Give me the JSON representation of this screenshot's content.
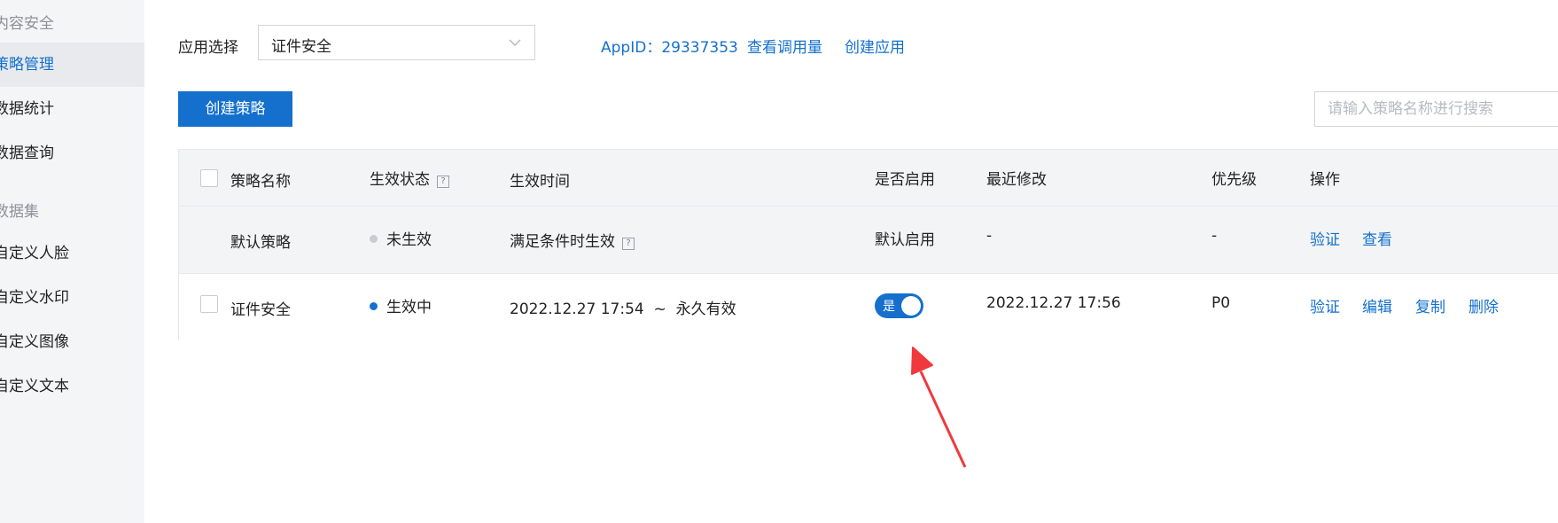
{
  "sidebar": {
    "group1": "内容安全",
    "items1": [
      {
        "label": "策略管理",
        "active": true
      },
      {
        "label": "数据统计",
        "active": false
      },
      {
        "label": "数据查询",
        "active": false
      }
    ],
    "group2": "数据集",
    "items2": [
      {
        "label": "自定义人脸"
      },
      {
        "label": "自定义水印"
      },
      {
        "label": "自定义图像"
      },
      {
        "label": "自定义文本"
      }
    ]
  },
  "toolbar": {
    "app_select_label": "应用选择",
    "app_select_value": "证件安全",
    "appid_label": "AppID：",
    "appid_value": "29337353",
    "view_usage": "查看调用量",
    "create_app": "创建应用",
    "create_strategy": "创建策略",
    "search_placeholder": "请输入策略名称进行搜索"
  },
  "table": {
    "headers": [
      "策略名称",
      "生效状态",
      "生效时间",
      "是否启用",
      "最近修改",
      "优先级",
      "操作"
    ],
    "rows": [
      {
        "name": "默认策略",
        "status": "未生效",
        "status_color": "#c9cbcf",
        "time": "满足条件时生效",
        "enabled": "默认启用",
        "modified": "-",
        "priority": "-",
        "actions": [
          "验证",
          "查看"
        ]
      },
      {
        "name": "证件安全",
        "status": "生效中",
        "status_color": "#1470cc",
        "time": "2022.12.27 17:54  ~  永久有效",
        "enabled_toggle_label": "是",
        "enabled_toggle_on": true,
        "modified": "2022.12.27 17:56",
        "priority": "P0",
        "actions": [
          "验证",
          "编辑",
          "复制",
          "删除"
        ]
      }
    ]
  },
  "colors": {
    "accent": "#1470cc",
    "arrow": "#f0393d"
  },
  "icons": [
    "chevron-down-icon",
    "question-icon",
    "status-dot-icon",
    "arrow-annotation-icon"
  ]
}
